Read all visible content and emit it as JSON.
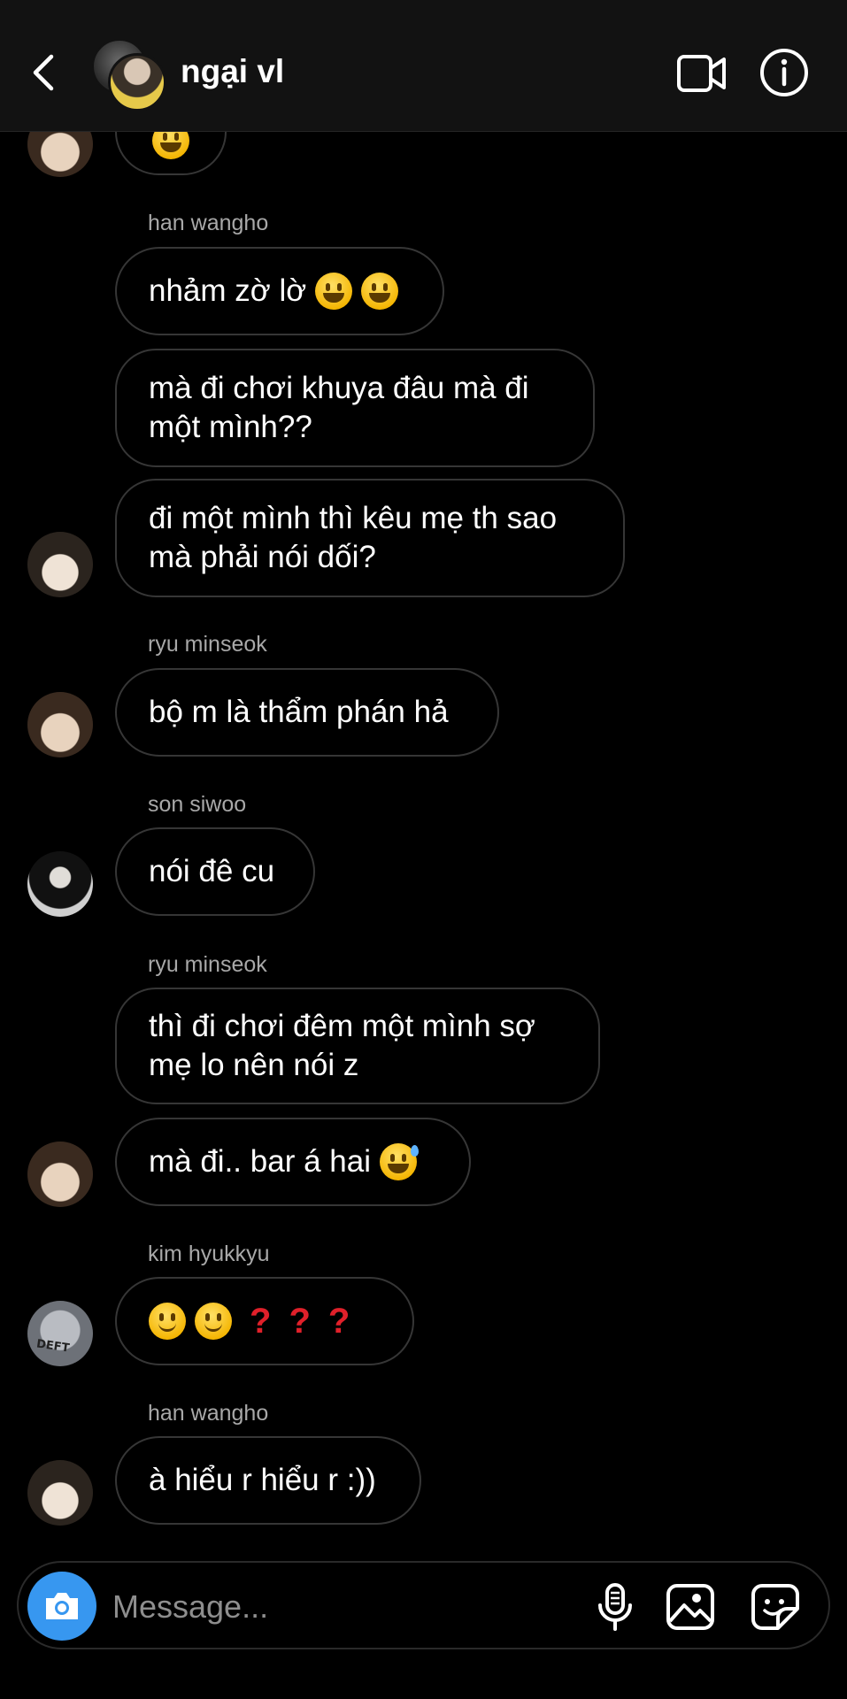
{
  "header": {
    "title": "ngại vl"
  },
  "messages": {
    "top_partial": {
      "sender": "",
      "text": ""
    },
    "m1": {
      "sender": "han wangho",
      "text": "nhảm zờ lờ"
    },
    "m2": {
      "text_line1": "mà đi chơi khuya đâu mà đi",
      "text_line2": "một mình??"
    },
    "m3": {
      "text_line1": "đi một mình thì kêu mẹ th sao",
      "text_line2": "mà phải nói dối?"
    },
    "m4": {
      "sender": "ryu minseok",
      "text": "bộ m là thẩm phán hả"
    },
    "m5": {
      "sender": "son siwoo",
      "text": "nói đê cu"
    },
    "m6": {
      "sender": "ryu minseok",
      "text_line1": "thì đi chơi đêm một mình sợ",
      "text_line2": "mẹ lo nên nói z"
    },
    "m7": {
      "text": "mà đi.. bar á hai"
    },
    "m8": {
      "sender": "kim hyukkyu",
      "qmarks": [
        "?",
        "?",
        "?"
      ]
    },
    "m9": {
      "sender": "han wangho",
      "text": "à hiểu r hiểu r :))"
    }
  },
  "avatars": {
    "kim_shirt_text": "DEFT"
  },
  "composer": {
    "placeholder": "Message..."
  },
  "colors": {
    "accent": "#3797f0",
    "bubble_border": "#363636",
    "sender": "#a8a8a8"
  },
  "icons": [
    "back-arrow-icon",
    "video-camera-icon",
    "info-icon",
    "camera-icon",
    "microphone-icon",
    "gallery-icon",
    "sticker-icon"
  ]
}
